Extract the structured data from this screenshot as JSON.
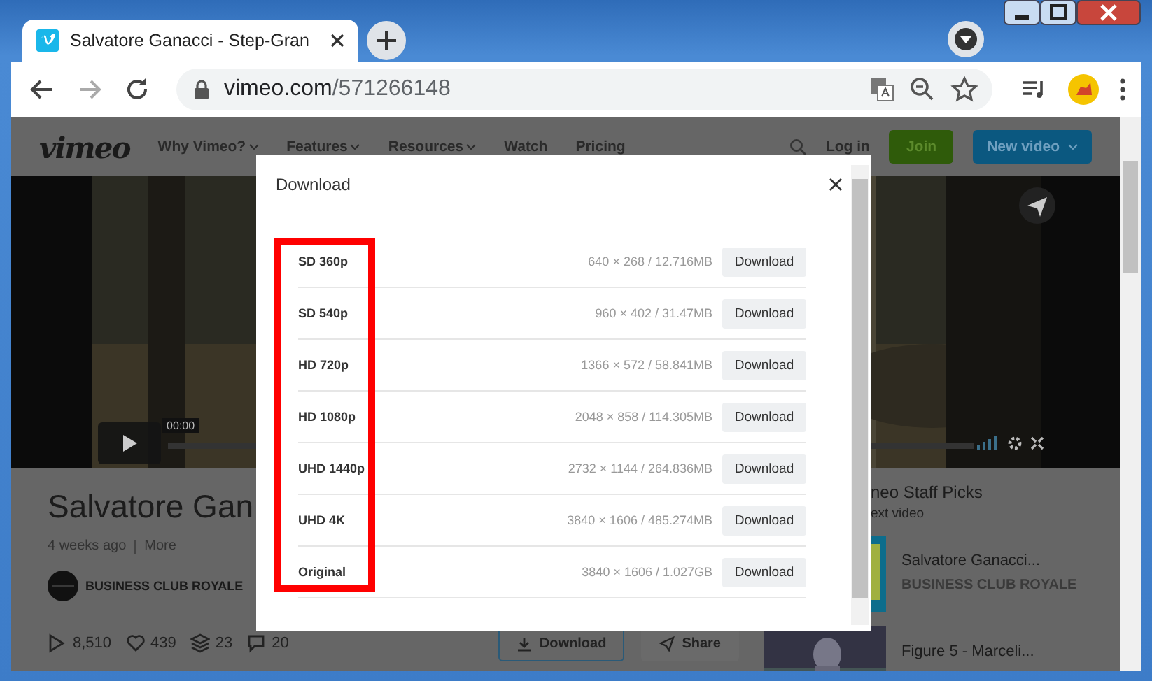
{
  "browser": {
    "tab_title": "Salvatore Ganacci - Step-Gran",
    "address_host": "vimeo.com",
    "address_path": "/571266148"
  },
  "site_nav": {
    "logo": "vimeo",
    "items": [
      {
        "label": "Why Vimeo?",
        "has_menu": true
      },
      {
        "label": "Features",
        "has_menu": true
      },
      {
        "label": "Resources",
        "has_menu": true
      },
      {
        "label": "Watch",
        "has_menu": false
      },
      {
        "label": "Pricing",
        "has_menu": false
      }
    ],
    "login": "Log in",
    "join": "Join",
    "new_video": "New video"
  },
  "player": {
    "time": "00:00"
  },
  "video": {
    "title": "Salvatore Gan",
    "age": "4 weeks ago",
    "more": "More",
    "channel": "BUSINESS CLUB ROYALE",
    "stats": [
      {
        "kind": "plays",
        "value": "8,510"
      },
      {
        "kind": "likes",
        "value": "439"
      },
      {
        "kind": "collections",
        "value": "23"
      },
      {
        "kind": "comments",
        "value": "20"
      }
    ],
    "actions": [
      {
        "kind": "download",
        "label": "Download"
      },
      {
        "kind": "share",
        "label": "Share"
      }
    ]
  },
  "sidebar": {
    "heading": "neo Staff Picks",
    "subheading": "ext video",
    "items": [
      {
        "title": "Salvatore Ganacci...",
        "channel": "BUSINESS CLUB ROYALE"
      },
      {
        "title": "Figure 5 - Marceli..."
      }
    ]
  },
  "dialog": {
    "title": "Download",
    "highlight": true,
    "rows": [
      {
        "quality": "SD 360p",
        "spec": "640 × 268 / 12.716MB",
        "button": "Download"
      },
      {
        "quality": "SD 540p",
        "spec": "960 × 402 / 31.47MB",
        "button": "Download"
      },
      {
        "quality": "HD 720p",
        "spec": "1366 × 572 / 58.841MB",
        "button": "Download"
      },
      {
        "quality": "HD 1080p",
        "spec": "2048 × 858 / 114.305MB",
        "button": "Download"
      },
      {
        "quality": "UHD 1440p",
        "spec": "2732 × 1144 / 264.836MB",
        "button": "Download"
      },
      {
        "quality": "UHD 4K",
        "spec": "3840 × 1606 / 485.274MB",
        "button": "Download"
      },
      {
        "quality": "Original",
        "spec": "3840 × 1606 / 1.027GB",
        "button": "Download"
      }
    ]
  }
}
